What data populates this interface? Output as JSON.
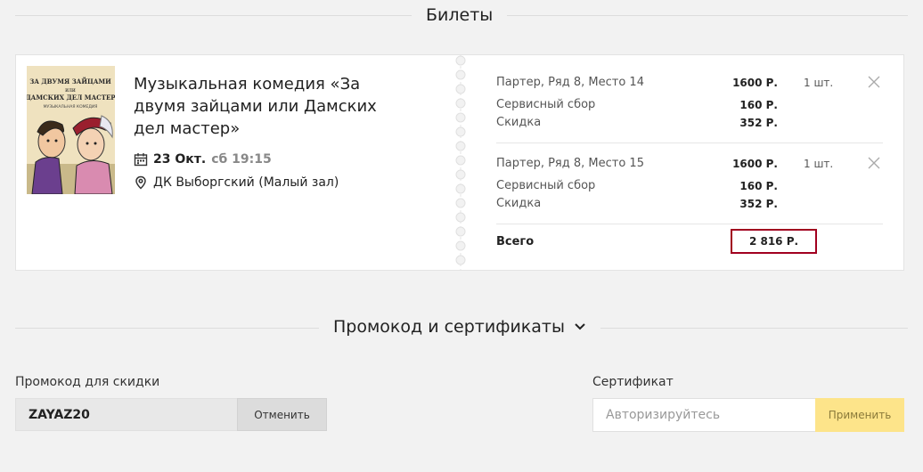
{
  "tickets_section": {
    "title": "Билеты"
  },
  "event": {
    "poster_alt": "poster-image",
    "poster_caption": "ЗА ДВУМЯ ЗАЙЦАМИ или ДАМСКИХ ДЕЛ МАСТЕР",
    "poster_subcaption": "МУЗЫКАЛЬНАЯ КОМЕДИЯ",
    "title": "Музыкальная комедия «За двумя зайцами или Дамских дел мастер»",
    "date": "23 Окт.",
    "time": "сб 19:15",
    "place": "ДК Выборгский (Малый зал)"
  },
  "seats": [
    {
      "seat": "Партер, Ряд 8, Место 14",
      "price": "1600 Р.",
      "qty": "1 шт.",
      "fee_label": "Сервисный сбор",
      "fee": "160 Р.",
      "discount_label": "Скидка",
      "discount": "352 Р."
    },
    {
      "seat": "Партер, Ряд 8, Место 15",
      "price": "1600 Р.",
      "qty": "1 шт.",
      "fee_label": "Сервисный сбор",
      "fee": "160 Р.",
      "discount_label": "Скидка",
      "discount": "352 Р."
    }
  ],
  "total": {
    "label": "Всего",
    "value": "2 816 Р."
  },
  "promo_section": {
    "title": "Промокод и сертификаты"
  },
  "promo": {
    "label": "Промокод для скидки",
    "value": "ZAYAZ20",
    "cancel_label": "Отменить"
  },
  "certificate": {
    "label": "Сертификат",
    "placeholder": "Авторизируйтесь",
    "apply_label": "Применить"
  },
  "colors": {
    "accent_red": "#a1001f",
    "apply_yellow": "#fde48a",
    "background": "#f2f2f2"
  }
}
